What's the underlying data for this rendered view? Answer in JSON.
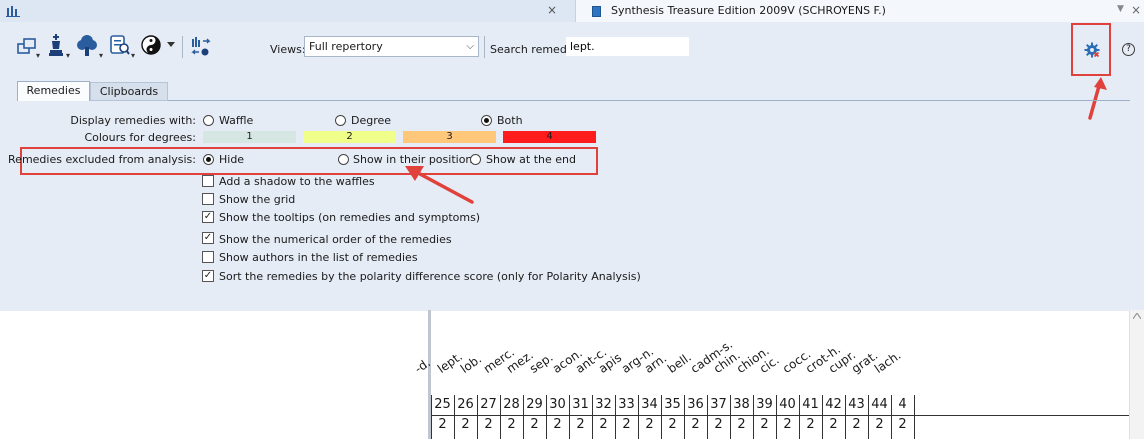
{
  "left_tab": {
    "close": "×"
  },
  "right_tab": {
    "title": "Synthesis Treasure Edition 2009V (SCHROYENS F.)",
    "menu": "▼",
    "close": "×"
  },
  "toolbar": {
    "views_label": "Views:",
    "views_value": "Full repertory",
    "search_label": "Search remedy:",
    "search_value": "lept."
  },
  "tabs": [
    "Remedies",
    "Clipboards"
  ],
  "options": {
    "display_label": "Display remedies with:",
    "display_options": [
      "Waffle",
      "Degree",
      "Both"
    ],
    "display_selected": "Both",
    "colours_label": "Colours for degrees:",
    "degrees": [
      {
        "label": "1",
        "color": "#d6e6e3"
      },
      {
        "label": "2",
        "color": "#f0ff8a"
      },
      {
        "label": "3",
        "color": "#ffc77a"
      },
      {
        "label": "4",
        "color": "#ff1c1c"
      }
    ],
    "excluded_label": "Remedies excluded from analysis:",
    "excluded_options": [
      "Hide",
      "Show in their position",
      "Show at the end"
    ],
    "excluded_selected": "Hide",
    "checkboxes": [
      {
        "label": "Add a shadow to the waffles",
        "checked": false
      },
      {
        "label": "Show the grid",
        "checked": false
      },
      {
        "label": "Show the tooltips (on remedies and symptoms)",
        "checked": true
      },
      {
        "label": "Show the numerical order of the remedies",
        "checked": true
      },
      {
        "label": "Show authors in the list of remedies",
        "checked": false
      },
      {
        "label": "Sort the remedies by the polarity difference score (only for Polarity Analysis)",
        "checked": true
      }
    ]
  },
  "help_icon": "?",
  "grid": {
    "remedies": [
      "-d.",
      "lept.",
      "lob.",
      "merc.",
      "mez.",
      "sep.",
      "acon.",
      "ant-c.",
      "apis",
      "arg-n.",
      "arn.",
      "bell.",
      "cadm-s.",
      "chin.",
      "chion.",
      "cic.",
      "cocc.",
      "crot-h.",
      "cupr.",
      "grat.",
      "lach."
    ],
    "numbers": [
      "25",
      "26",
      "27",
      "28",
      "29",
      "30",
      "31",
      "32",
      "33",
      "34",
      "35",
      "36",
      "37",
      "38",
      "39",
      "40",
      "41",
      "42",
      "43",
      "44",
      "4"
    ],
    "degrees": [
      "2",
      "2",
      "2",
      "2",
      "2",
      "2",
      "2",
      "2",
      "2",
      "2",
      "2",
      "2",
      "2",
      "2",
      "2",
      "2",
      "2",
      "2",
      "2",
      "2",
      "2"
    ]
  },
  "accent": "#e0413b"
}
